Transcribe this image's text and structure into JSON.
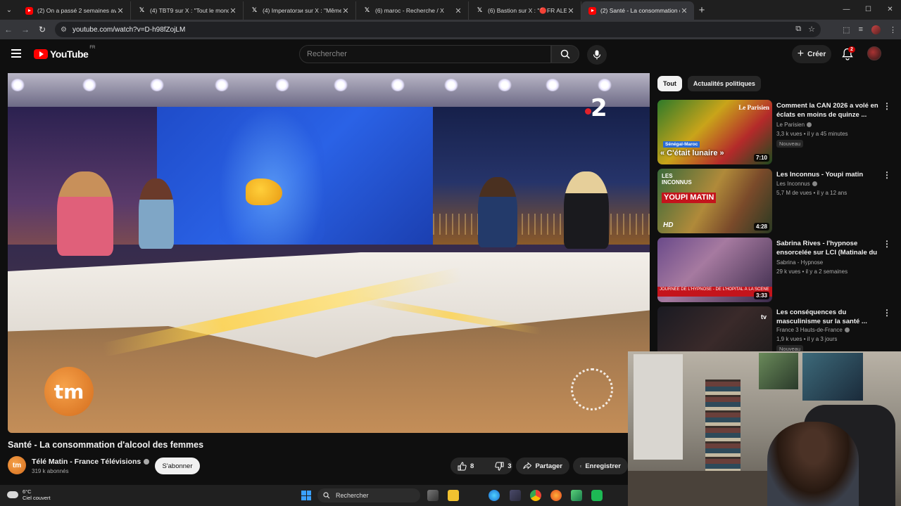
{
  "browser": {
    "tabs": [
      {
        "favicon": "youtube",
        "title": "(2) On a passé 2 semaines avec",
        "active": false
      },
      {
        "favicon": "x",
        "title": "(4) TBT9 sur X : \"Tout le monde",
        "active": false
      },
      {
        "favicon": "x",
        "title": "(4) Imperatorзи sur X : \"Même",
        "active": false
      },
      {
        "favicon": "x",
        "title": "(6) maroc - Recherche / X",
        "active": false
      },
      {
        "favicon": "x",
        "title": "(6) Bastion sur X : \"🔴FR ALERT",
        "active": false
      },
      {
        "favicon": "youtube",
        "title": "(2) Santé - La consommation d",
        "active": true
      }
    ],
    "new_tab": "+",
    "url": "youtube.com/watch?v=D-h98fZojLM",
    "window_controls": [
      "—",
      "☐",
      "✕"
    ]
  },
  "youtube": {
    "logo_text": "YouTube",
    "country_code": "FR",
    "search_placeholder": "Rechercher",
    "create_label": "Créer",
    "notification_count": "2"
  },
  "player": {
    "channel_watermark": "tm",
    "broadcaster_logo": "2"
  },
  "video": {
    "title": "Santé - La consommation d'alcool des femmes",
    "channel": "Télé Matin - France Télévisions",
    "channel_avatar": "tm",
    "subscribers": "319 k abonnés",
    "subscribe_label": "S'abonner",
    "likes": "8",
    "dislikes": "3",
    "share_label": "Partager",
    "save_label": "Enregistrer"
  },
  "sidebar": {
    "chips": [
      {
        "label": "Tout",
        "selected": true
      },
      {
        "label": "Actualités politiques",
        "selected": false
      }
    ],
    "recommendations": [
      {
        "title": "Comment la CAN 2026 a volé en éclats en moins de quinze ...",
        "channel": "Le Parisien",
        "verified": true,
        "meta": "3,3 k vues • il y a 45 minutes",
        "badge": "Nouveau",
        "duration": "7:10",
        "thumb_caption": "« C'était lunaire »",
        "thumb_tag": "Sénégal-Maroc",
        "thumb_brand": "Le Parisien"
      },
      {
        "title": "Les Inconnus - Youpi matin",
        "channel": "Les Inconnus",
        "verified": true,
        "meta": "5,7 M de vues • il y a 12 ans",
        "badge": "",
        "duration": "4:28",
        "thumb_caption": "YOUPI MATIN",
        "thumb_tag": "HD",
        "thumb_brand": "LES INCONNUS"
      },
      {
        "title": "Sabrina Rives - l'hypnose ensorcelée sur LCI (Matinale du ...",
        "channel": "Sabrina - Hypnose",
        "verified": false,
        "meta": "29 k vues • il y a 2 semaines",
        "badge": "",
        "duration": "3:33",
        "thumb_caption": "JOURNÉE DE L'HYPNOSE - DE L'HÔPITAL À LA SCÈNE",
        "thumb_tag": "",
        "thumb_brand": ""
      },
      {
        "title": "Les conséquences du masculinisme sur la santé ...",
        "channel": "France 3 Hauts-de-France",
        "verified": true,
        "meta": "1,9 k vues • il y a 3 jours",
        "badge": "Nouveau",
        "duration": "",
        "thumb_caption": "",
        "thumb_tag": "",
        "thumb_brand": "tv"
      }
    ]
  },
  "taskbar": {
    "temperature": "6°C",
    "weather": "Ciel couvert",
    "search_placeholder": "Rechercher"
  },
  "colors": {
    "youtube_red": "#ff0000",
    "background": "#0f0f0f",
    "chip_selected": "#f1f1f1",
    "notification_badge": "#cc0000"
  }
}
